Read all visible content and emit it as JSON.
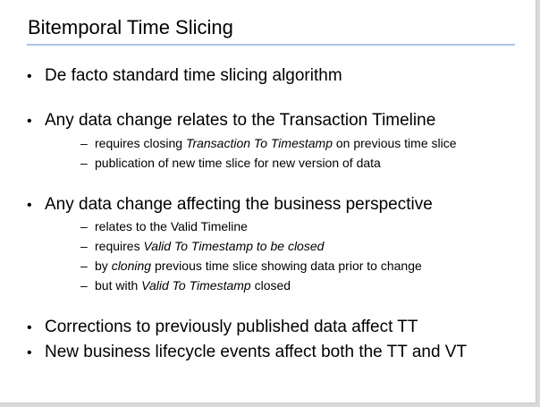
{
  "slide": {
    "title": "Bitemporal Time Slicing",
    "bullet_marker": "•",
    "dash_marker": "–",
    "b1": "De facto standard time slicing algorithm",
    "b2": "Any data change relates to the Transaction Timeline",
    "b2s1": {
      "a": "requires closing ",
      "i": "Transaction To Timestamp",
      "b": " on previous time slice"
    },
    "b2s2": "publication of new time slice for new version of data",
    "b3": "Any data change affecting the business perspective",
    "b3s1": "relates to the Valid Timeline",
    "b3s2": {
      "a": "requires ",
      "i": "Valid To Timestamp to be closed"
    },
    "b3s3": {
      "a": "by ",
      "i": "cloning",
      "b": " previous time slice showing data prior to change"
    },
    "b3s4": {
      "a": "but with ",
      "i": "Valid To Timestamp",
      "b": " closed"
    },
    "b4": "Corrections to previously published data affect TT",
    "b5": "New business lifecycle events affect both the TT and VT"
  }
}
